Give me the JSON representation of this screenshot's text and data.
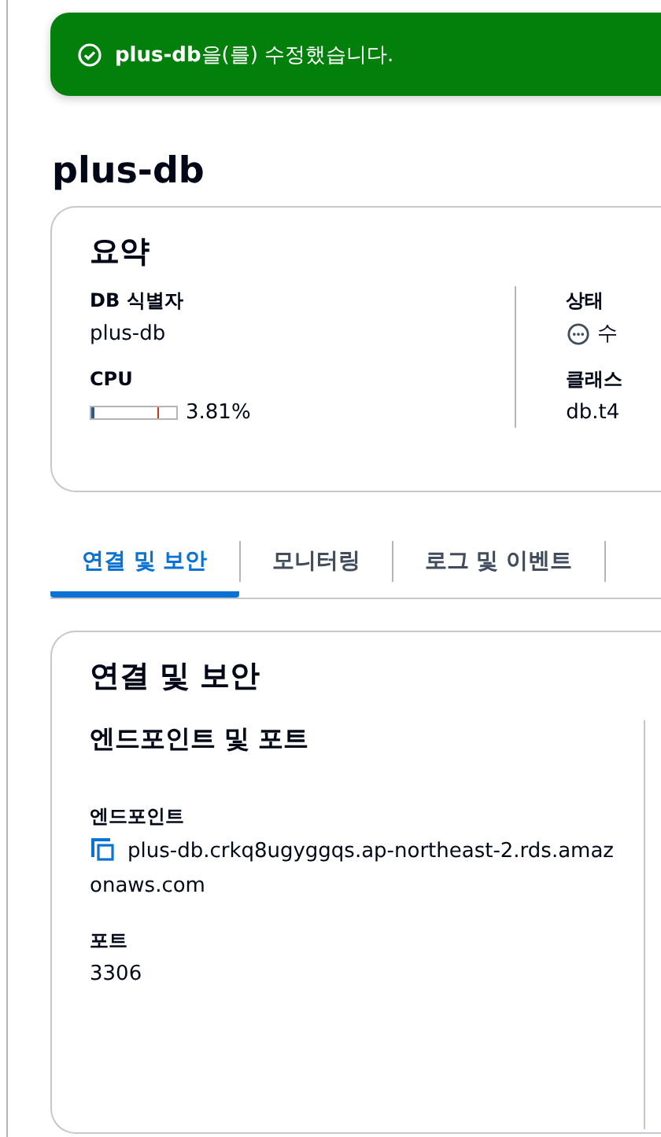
{
  "flash": {
    "text": "**plus-db**을(를) 수정했습니다."
  },
  "page_title": "plus-db",
  "summary": {
    "title": "요약",
    "left": [
      {
        "kind": "text",
        "label": "DB 식별자",
        "value": "plus-db"
      },
      {
        "kind": "meter",
        "label": "CPU",
        "level": 0.0381,
        "value": "3.81%"
      }
    ],
    "right": [
      {
        "kind": "status",
        "label": "상태",
        "value": "수"
      },
      {
        "kind": "text",
        "label": "클래스",
        "value": "db.t4"
      }
    ]
  },
  "tabs": [
    {
      "label": "연결 및 보안",
      "selected": true
    },
    {
      "label": "모니터링",
      "selected": false
    },
    {
      "label": "로그 및 이벤트",
      "selected": false
    }
  ],
  "panel": {
    "title": "연결 및 보안",
    "subtitle": "엔드포인트 및 포트",
    "fields": [
      {
        "kind": "copy",
        "label": "엔드포인트",
        "value": "plus-db.crkq8ugyggqs.ap-northeast-2.rds.amazonaws.com"
      },
      {
        "kind": "text",
        "label": "포트",
        "value": "3306"
      }
    ]
  }
}
